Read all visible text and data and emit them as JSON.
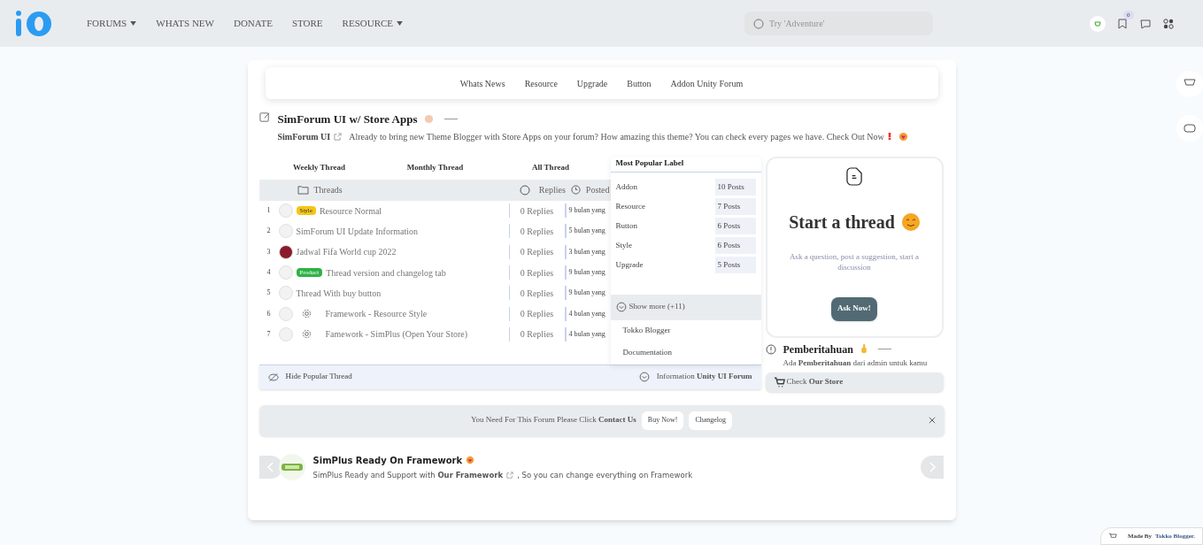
{
  "header": {
    "nav": [
      {
        "label": "FORUMS",
        "caret": true
      },
      {
        "label": "WHATS NEW",
        "caret": false
      },
      {
        "label": "DONATE",
        "caret": false
      },
      {
        "label": "STORE",
        "caret": false
      },
      {
        "label": "RESOURCE",
        "caret": true
      }
    ],
    "search": {
      "placeholder": "Try 'Adventure'"
    },
    "badge": "0"
  },
  "subnav": [
    "Whats News",
    "Resource",
    "Upgrade",
    "Button",
    "Addon Unity Forum"
  ],
  "title": "SimForum UI w/ Store Apps",
  "intro": {
    "link": "SimForum UI",
    "text": "Already to bring new Theme Blogger with Store Apps on your forum? How amazing this theme? You can check every pages we have. Check Out Now"
  },
  "tabs": [
    "Weekly Thread",
    "Monthly Thread",
    "All Thread"
  ],
  "columns": {
    "threads": "Threads",
    "replies": "Replies",
    "posted": "Posted"
  },
  "threads": [
    {
      "number": "1",
      "tag": {
        "label": "Style",
        "color": "#f5c518"
      },
      "title": "Resource Normal",
      "gear": false,
      "replies": "0 Replies",
      "posted": "9 bulan yang"
    },
    {
      "number": "2",
      "title": "SimForum UI Update Information",
      "gear": false,
      "replies": "0 Replies",
      "posted": "5 bulan yang"
    },
    {
      "number": "3",
      "title": "Jadwal Fifa World cup 2022",
      "gear": false,
      "replies": "0 Replies",
      "posted": "3 bulan yang"
    },
    {
      "number": "4",
      "tag": {
        "label": "Product",
        "color": "#2fb344"
      },
      "title": "Thread version and changelog tab",
      "gear": false,
      "replies": "0 Replies",
      "posted": "9 bulan yang"
    },
    {
      "number": "5",
      "title": "Thread With buy button",
      "gear": false,
      "replies": "0 Replies",
      "posted": "9 bulan yang"
    },
    {
      "number": "6",
      "title": "Framework - Resource Style",
      "gear": true,
      "replies": "0 Replies",
      "posted": "4 bulan yang"
    },
    {
      "number": "7",
      "title": "Famework - SimPlus (Open Your Store)",
      "gear": true,
      "replies": "0 Replies",
      "posted": "4 bulan yang"
    }
  ],
  "popular": {
    "title": "Most Popular Label",
    "labels": [
      {
        "name": "Addon",
        "count": "10 Posts"
      },
      {
        "name": "Resource",
        "count": "7 Posts"
      },
      {
        "name": "Button",
        "count": "6 Posts"
      },
      {
        "name": "Style",
        "count": "6 Posts"
      },
      {
        "name": "Upgrade",
        "count": "5 Posts"
      }
    ],
    "show_more": "Show more (+11)",
    "links": [
      "Tokko Blogger",
      "Documentation"
    ]
  },
  "hide_bar": {
    "hide": "Hide Popular Thread",
    "info": "Information **Unity UI Forum**"
  },
  "start_card": {
    "title": "Start a thread",
    "description": "Ask a question, post a suggestion, start a discussion",
    "button": "Ask Now!"
  },
  "notice": {
    "title": "Pemberitahuan",
    "text": "Ada **Pemberitahuan** dari admin untuk kamu",
    "store": "Check **Our Store**"
  },
  "banner": {
    "text": "You Need For This Forum Please Click **Contact Us**",
    "buttons": [
      "Buy Now!",
      "Changelog"
    ]
  },
  "promo": {
    "title": "SimPlus Ready On Framework",
    "text_before": "SimPlus Ready and Support with **Our Framework**",
    "text_after": ", So you can change everything on Framework"
  },
  "footer": {
    "prefix": "Made By",
    "link": "Tokko Blogger."
  }
}
